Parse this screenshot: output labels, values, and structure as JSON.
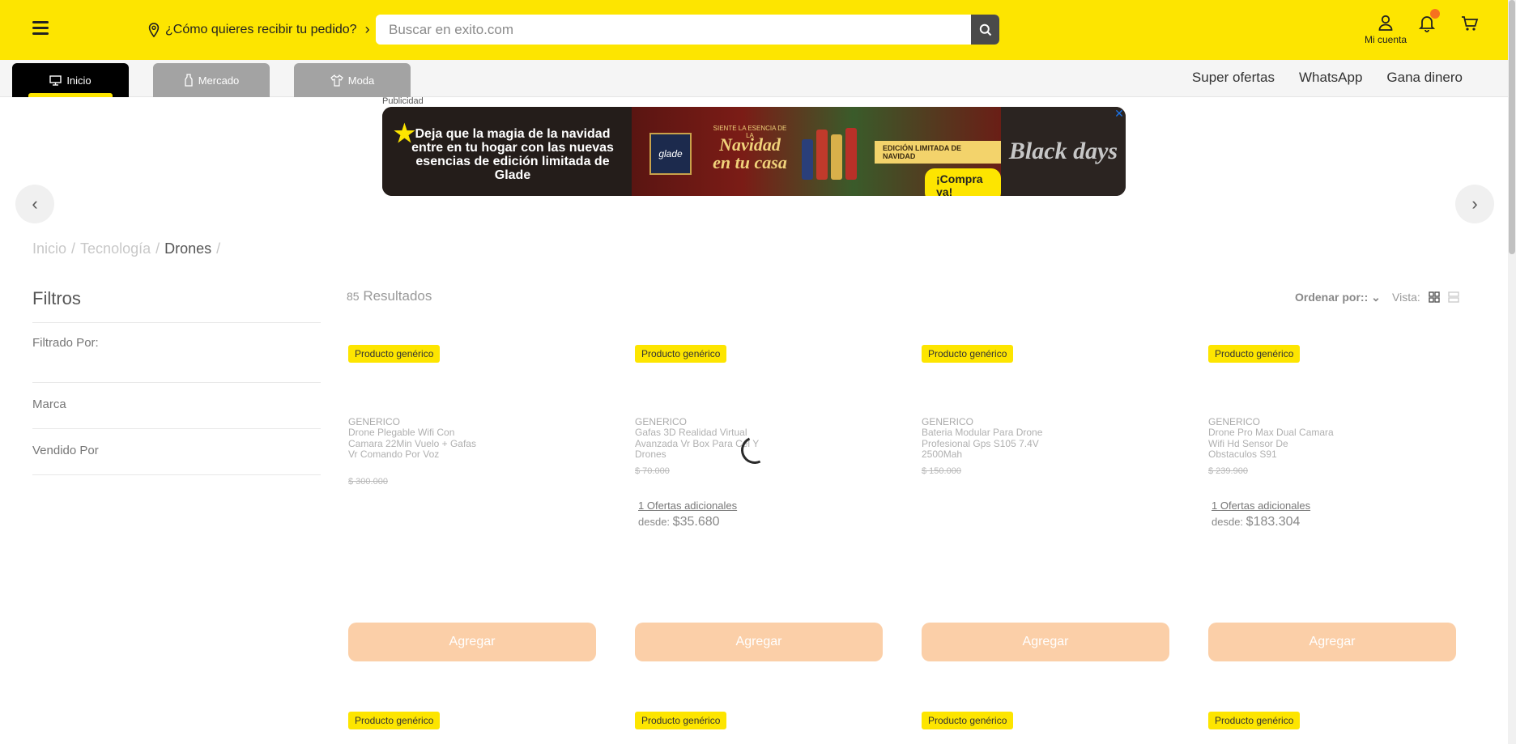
{
  "header": {
    "delivery_label": "¿Cómo quieres recibir tu pedido?",
    "search_placeholder": "Buscar en exito.com",
    "account_label": "Mi cuenta"
  },
  "nav": {
    "tabs": [
      {
        "label": "Inicio",
        "icon": "monitor-icon"
      },
      {
        "label": "Mercado",
        "icon": "bottle-icon"
      },
      {
        "label": "Moda",
        "icon": "shirt-icon"
      }
    ],
    "links": [
      "Super ofertas",
      "WhatsApp",
      "Gana dinero"
    ]
  },
  "ad": {
    "label": "Publicidad",
    "headline": "Deja que la magia de la navidad entre en tu hogar con las nuevas esencias de edición limitada de Glade",
    "glade": "glade",
    "tagline_top": "SIENTE LA ESENCIA DE LA",
    "tagline_main": "Navidad en tu casa",
    "ribbon": "EDICIÓN LIMITADA DE NAVIDAD",
    "cta": "¡Compra ya!",
    "campaign": "Black days"
  },
  "breadcrumb": [
    "Inicio",
    "Tecnología",
    "Drones"
  ],
  "filters": {
    "title": "Filtros",
    "filtered_by": "Filtrado Por:",
    "groups": [
      "Marca",
      "Vendido Por"
    ]
  },
  "results": {
    "count": "85",
    "label": "Resultados",
    "sort_label": "Ordenar por::",
    "view_label": "Vista:"
  },
  "products": [
    {
      "badge": "Producto genérico",
      "brand": "GENERICO",
      "name": "Drone Plegable Wifi Con Camara 22Min Vuelo + Gafas Vr Comando Por Voz",
      "old_price": "$ 300.000",
      "offers": "",
      "desde_label": "",
      "price": "",
      "button": "Agregar"
    },
    {
      "badge": "Producto genérico",
      "brand": "GENERICO",
      "name": "Gafas 3D Realidad Virtual Avanzada Vr Box Para Cel Y Drones",
      "old_price": "$ 70.000",
      "offers": "1 Ofertas adicionales",
      "desde_label": "desde:",
      "price": "$35.680",
      "button": "Agregar"
    },
    {
      "badge": "Producto genérico",
      "brand": "GENERICO",
      "name": "Bateria Modular Para Drone Profesional Gps S105 7.4V 2500Mah",
      "old_price": "$ 150.000",
      "offers": "",
      "desde_label": "",
      "price": "",
      "button": "Agregar"
    },
    {
      "badge": "Producto genérico",
      "brand": "GENERICO",
      "name": "Drone Pro Max Dual Camara Wifi Hd Sensor De Obstaculos S91",
      "old_price": "$ 239.900",
      "offers": "1 Ofertas adicionales",
      "desde_label": "desde:",
      "price": "$183.304",
      "button": "Agregar"
    }
  ],
  "next_row_badges": [
    "Producto genérico",
    "Producto genérico",
    "Producto genérico",
    "Producto genérico"
  ],
  "colors": {
    "brand_yellow": "#fde500",
    "button_peach": "#fbcfa8",
    "notification_dot": "#f7711f"
  }
}
